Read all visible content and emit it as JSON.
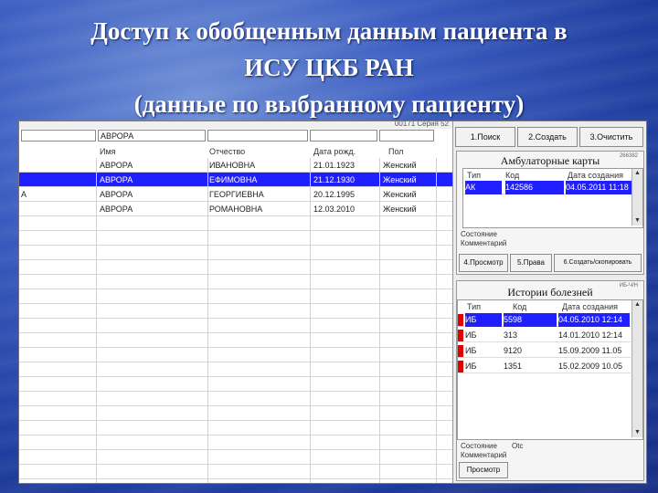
{
  "slide": {
    "title_line1": "Доступ к обобщенным данным пациента в",
    "title_line2": "ИСУ ЦКБ РАН",
    "title_line3": "(данные по выбранному пациенту)"
  },
  "app": {
    "top_caption": "00171  Серия 52",
    "filter_surname": "",
    "filter_name": "АВРОРА",
    "columns": [
      "Имя",
      "Отчество",
      "Дата рожд.",
      "Пол"
    ],
    "rows": [
      {
        "mark": "",
        "name": "АВРОРА",
        "patronymic": "ИВАНОВНА",
        "dob": "21.01.1923",
        "sex": "Женский",
        "selected": false
      },
      {
        "mark": "",
        "name": "АВРОРА",
        "patronymic": "ЕФИМОВНА",
        "dob": "21.12.1930",
        "sex": "Женский",
        "selected": true
      },
      {
        "mark": "А",
        "name": "АВРОРА",
        "patronymic": "ГЕОРГИЕВНА",
        "dob": "20.12.1995",
        "sex": "Женский",
        "selected": false
      },
      {
        "mark": "",
        "name": "АВРОРА",
        "patronymic": "РОМАНОВНА",
        "dob": "12.03.2010",
        "sex": "Женский",
        "selected": false
      }
    ],
    "buttons": {
      "search": "1.Поиск",
      "create": "2.Создать",
      "clear": "3.Очистить"
    },
    "amb": {
      "title": "Амбулаторные карты",
      "corner": "266382",
      "col_type": "Тип",
      "col_code": "Код",
      "col_date": "Дата создания",
      "rows": [
        {
          "type": "АК",
          "code": "142586",
          "date": "04.05.2011 11:18",
          "selected": true
        }
      ],
      "state_label": "Состояние",
      "comment_label": "Комментарий",
      "btn_view": "4.Просмотр",
      "btn_rights": "5.Права",
      "btn_edit": "6.Создать/скопировать"
    },
    "hist": {
      "title": "Истории болезней",
      "corner": "ИБ-Ч/Н",
      "col_type": "Тип",
      "col_code": "Код",
      "col_date": "Дата создания",
      "rows": [
        {
          "type": "ИБ",
          "code": "5598",
          "date": "04.05.2010 12:14",
          "selected": true,
          "red": true
        },
        {
          "type": "ИБ",
          "code": "313",
          "date": "14.01.2010 12:14",
          "selected": false,
          "red": true
        },
        {
          "type": "ИБ",
          "code": "9120",
          "date": "15.09.2009 11.05",
          "selected": false,
          "red": true
        },
        {
          "type": "ИБ",
          "code": "1351",
          "date": "15.02.2009 10.05",
          "selected": false,
          "red": true
        }
      ],
      "state_label": "Состояние",
      "state_value": "Otc",
      "comment_label": "Комментарий",
      "btn_view": "Просмотр"
    }
  }
}
